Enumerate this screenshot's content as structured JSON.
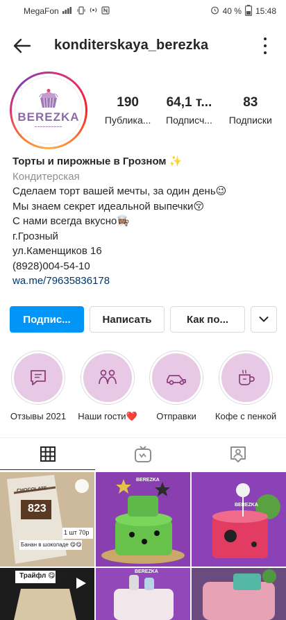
{
  "status_bar": {
    "carrier": "MegaFon",
    "battery": "40 %",
    "time": "15:48"
  },
  "header": {
    "username": "konditerskaya_berezka",
    "back_icon": "arrow-left-icon",
    "more_icon": "more-vertical-icon"
  },
  "profile": {
    "avatar_logo_text": "BEREZKA",
    "stats": [
      {
        "value": "190",
        "label": "Публика..."
      },
      {
        "value": "64,1 т...",
        "label": "Подписч..."
      },
      {
        "value": "83",
        "label": "Подписки"
      }
    ]
  },
  "bio": {
    "name": "Торты и пирожные в Грозном",
    "name_emoji": "✨",
    "category": "Кондитерская",
    "line1": "Сделаем торт вашей мечты, за один день",
    "line1_emoji": "😉",
    "line2": "Мы знаем секрет идеальной выпечки",
    "line2_emoji": "😚",
    "line3": "С нами всегда вкусно",
    "line3_emoji": "👩🏽‍🍳",
    "city": "г.Грозный",
    "address": "ул.Каменщиков 16",
    "phone": "(8928)004-54-10",
    "link": "wa.me/79635836178"
  },
  "actions": {
    "follow_label": "Подпис...",
    "message_label": "Написать",
    "contact_label": "Как по...",
    "more_icon": "chevron-down-icon"
  },
  "highlights": [
    {
      "label": "Отзывы 2021",
      "icon": "message-icon"
    },
    {
      "label": "Наши гости❤️",
      "icon": "people-icon"
    },
    {
      "label": "Отправки",
      "icon": "car-icon"
    },
    {
      "label": "Кофе с пенкой",
      "icon": "coffee-cup-icon"
    }
  ],
  "tabs": [
    {
      "name": "grid",
      "icon": "grid-icon",
      "active": true
    },
    {
      "name": "igtv",
      "icon": "igtv-icon",
      "active": false
    },
    {
      "name": "tagged",
      "icon": "tagged-user-icon",
      "active": false
    }
  ],
  "grid_posts": [
    {
      "overlay_price": "1 шт 70р",
      "overlay_caption": "Банан в шоколаде 😋😋",
      "chocolate_number": "823",
      "brand": "CHOCOLATE"
    },
    {
      "brand": "BEREZKA"
    },
    {
      "brand": "BEREZKA"
    },
    {
      "overlay_caption": "Трайфл 😋😋"
    },
    {
      "brand": "BEREZKA"
    },
    {}
  ],
  "colors": {
    "accent_blue": "#0095f6",
    "highlight_bg": "#e7c8e5",
    "logo_purple": "#8b6aa7"
  }
}
